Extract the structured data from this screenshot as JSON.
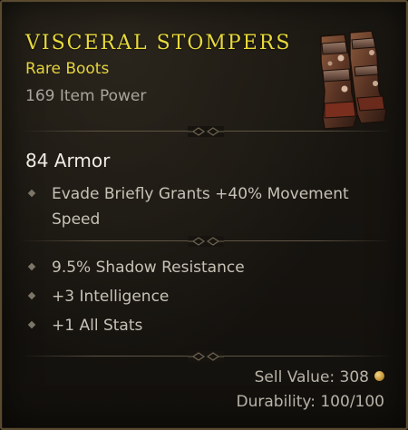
{
  "item": {
    "name": "VISCERAL STOMPERS",
    "rarity": "Rare Boots",
    "item_power": "169 Item Power",
    "image_icon": "boots-icon"
  },
  "armor": "84 Armor",
  "implicit_affixes": [
    {
      "text": "Evade Briefly Grants +40% Movement Speed"
    }
  ],
  "affixes": [
    {
      "text": "9.5% Shadow Resistance"
    },
    {
      "text": "+3 Intelligence"
    },
    {
      "text": "+1 All Stats"
    }
  ],
  "footer": {
    "sell_value": "Sell Value: 308",
    "durability": "Durability: 100/100",
    "currency_icon": "gold-coin-icon"
  },
  "colors": {
    "rare": "#e8da3c",
    "border": "#5a4a30",
    "background": "#171410"
  }
}
